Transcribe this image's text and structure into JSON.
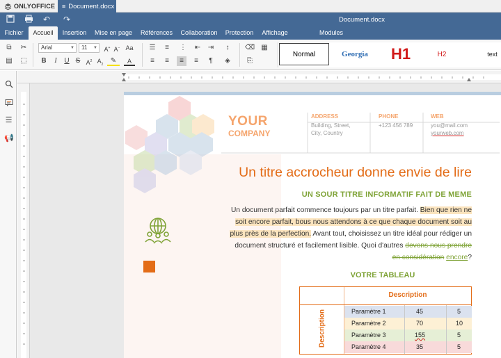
{
  "app": {
    "logo_text": "ONLYOFFICE",
    "tab_label": "Document.docx",
    "window_title": "Document.docx"
  },
  "menu": {
    "tabs": [
      {
        "label": "Fichier"
      },
      {
        "label": "Accueil",
        "active": true
      },
      {
        "label": "Insertion"
      },
      {
        "label": "Mise en page"
      },
      {
        "label": "Références"
      },
      {
        "label": "Collaboration"
      },
      {
        "label": "Protection"
      },
      {
        "label": "Affichage"
      },
      {
        "label": "Modules complémentaires"
      }
    ]
  },
  "toolbar": {
    "font_name": "Arial",
    "font_size": "11",
    "styles": [
      {
        "label": "Normal"
      },
      {
        "label": "Georgia"
      },
      {
        "label": "H1"
      },
      {
        "label": "H2"
      },
      {
        "label": "text"
      }
    ]
  },
  "document": {
    "company_line1": "YOUR",
    "company_line2": "COMPANY",
    "address_label": "ADDRESS",
    "address_line1": "Building, Street,",
    "address_line2": "City, Country",
    "phone_label": "PHONE",
    "phone_value": "+123 456 789",
    "web_label": "WEB",
    "web_email": "you@mail.com",
    "web_site": "yourweb.com",
    "title": "Un titre accrocheur donne envie de lire",
    "subtitle": "UN SOUR TITRE INFORMATIF FAIT DE MEME",
    "para_plain1": "Un document parfait commence toujours par un titre parfait. ",
    "para_highlight": "Bien que rien ne soit encore parfait, bous nous attendons à ce que chaque document soit au plus près de la perfection.",
    "para_plain2": " Avant tout, choisissez un titre idéal pour rédiger un document structuré et facilement lisible. Quoi d'autres ",
    "para_strike": "devons nous prendre en considération",
    "para_space": " ",
    "para_underline": "encore",
    "para_end": "?",
    "table_title": "VOTRE TABLEAU",
    "table": {
      "header": "Description",
      "side_label": "Description",
      "rows": [
        {
          "name": "Paramètre 1",
          "a": "45",
          "b": "5",
          "color": "#dbe2ef"
        },
        {
          "name": "Paramètre 2",
          "a": "70",
          "b": "10",
          "color": "#fdf0d5"
        },
        {
          "name": "Paramètre 3",
          "a": "155",
          "b": "5",
          "color": "#e6efd6"
        },
        {
          "name": "Paramètre 4",
          "a": "35",
          "b": "5",
          "color": "#f8dada"
        }
      ]
    }
  },
  "colors": {
    "brand_blue": "#446995",
    "accent_orange": "#e36c17",
    "accent_green": "#7fa337",
    "light_orange": "#f5a56d"
  }
}
